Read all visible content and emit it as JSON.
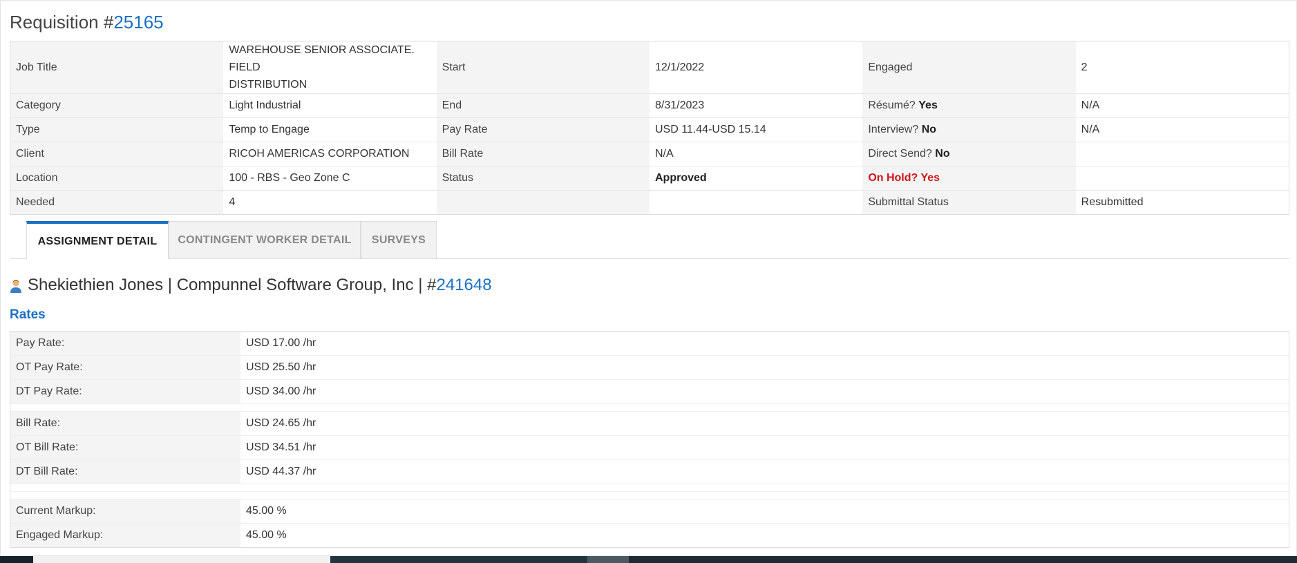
{
  "header": {
    "title_prefix": "Requisition #",
    "req_number": "25165"
  },
  "requisition": {
    "job_title_label": "Job Title",
    "job_title_line1": "WAREHOUSE SENIOR ASSOCIATE. FIELD",
    "job_title_line2": "DISTRIBUTION",
    "start_label": "Start",
    "start": "12/1/2022",
    "engaged_label": "Engaged",
    "engaged": "2",
    "category_label": "Category",
    "category": "Light Industrial",
    "end_label": "End",
    "end": "8/31/2023",
    "resume_label": "Résumé?",
    "resume": "Yes",
    "resume_value": "N/A",
    "type_label": "Type",
    "type": "Temp to Engage",
    "pay_rate_label": "Pay Rate",
    "pay_rate": "USD 11.44-USD 15.14",
    "interview_label": "Interview?",
    "interview": "No",
    "interview_value": "N/A",
    "client_label": "Client",
    "client": "RICOH AMERICAS CORPORATION",
    "bill_rate_label": "Bill Rate",
    "bill_rate": "N/A",
    "direct_send_label": "Direct Send?",
    "direct_send": "No",
    "location_label": "Location",
    "location": "100 - RBS - Geo Zone C",
    "status_label": "Status",
    "status": "Approved",
    "on_hold_text": "On Hold? Yes",
    "needed_label": "Needed",
    "needed": "4",
    "submittal_status_label": "Submittal Status",
    "submittal_status": "Resubmitted"
  },
  "tabs": [
    {
      "label": "ASSIGNMENT DETAIL"
    },
    {
      "label": "CONTINGENT WORKER DETAIL"
    },
    {
      "label": "SURVEYS"
    }
  ],
  "worker": {
    "text": "Shekiethien Jones | Compunnel Software Group, Inc | #",
    "id": "241648"
  },
  "rates": {
    "heading": "Rates",
    "pay_rate_label": "Pay Rate:",
    "pay_rate": "USD 17.00 /hr",
    "ot_pay_rate_label": "OT Pay Rate:",
    "ot_pay_rate": "USD 25.50 /hr",
    "dt_pay_rate_label": "DT Pay Rate:",
    "dt_pay_rate": "USD 34.00 /hr",
    "bill_rate_label": "Bill Rate:",
    "bill_rate": "USD 24.65 /hr",
    "ot_bill_rate_label": "OT Bill Rate:",
    "ot_bill_rate": "USD 34.51 /hr",
    "dt_bill_rate_label": "DT Bill Rate:",
    "dt_bill_rate": "USD 44.37 /hr",
    "current_markup_label": "Current Markup:",
    "current_markup": "45.00 %",
    "engaged_markup_label": "Engaged Markup:",
    "engaged_markup": "45.00 %"
  },
  "colors": {
    "link": "#1a6fc4",
    "alert": "#d0141a",
    "label_bg": "#f4f4f4"
  },
  "icons": {
    "worker": "person-icon"
  }
}
